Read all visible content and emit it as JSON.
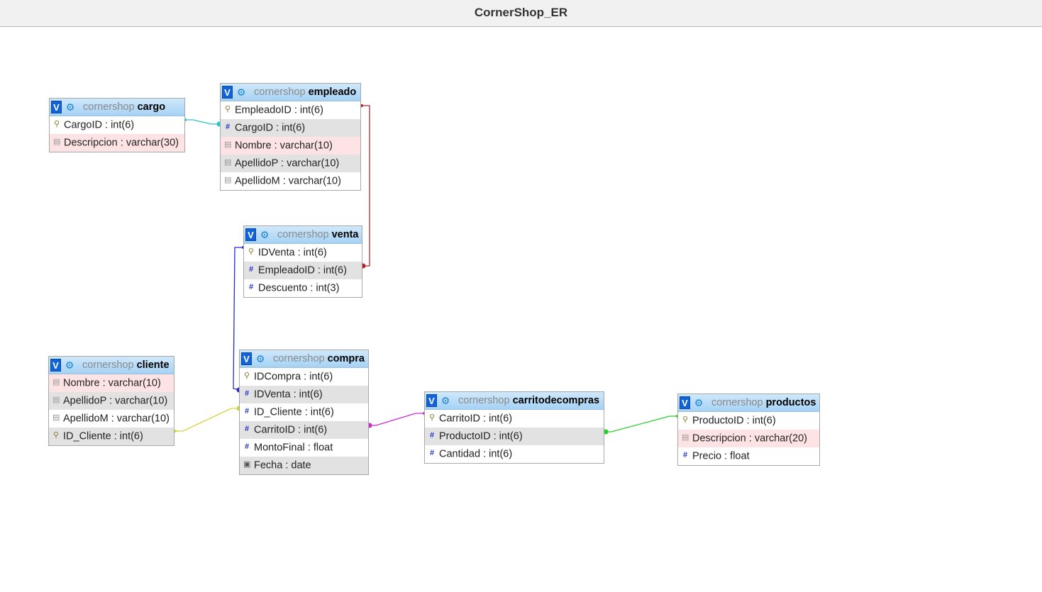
{
  "title": "CornerShop_ER",
  "tables": {
    "cargo": {
      "schema": "cornershop",
      "name": "cargo",
      "columns": [
        {
          "icon": "key-icon",
          "text": "CargoID : int(6)"
        },
        {
          "icon": "text-icon",
          "text": "Descripcion : varchar(30)"
        }
      ]
    },
    "empleado": {
      "schema": "cornershop",
      "name": "empleado",
      "columns": [
        {
          "icon": "key-icon",
          "text": "EmpleadoID : int(6)"
        },
        {
          "icon": "number-icon",
          "text": "CargoID : int(6)"
        },
        {
          "icon": "text-icon",
          "text": "Nombre : varchar(10)"
        },
        {
          "icon": "text-icon",
          "text": "ApellidoP : varchar(10)"
        },
        {
          "icon": "text-icon",
          "text": "ApellidoM : varchar(10)"
        }
      ]
    },
    "venta": {
      "schema": "cornershop",
      "name": "venta",
      "columns": [
        {
          "icon": "key-icon",
          "text": "IDVenta : int(6)"
        },
        {
          "icon": "number-icon",
          "text": "EmpleadoID : int(6)"
        },
        {
          "icon": "number-icon",
          "text": "Descuento : int(3)"
        }
      ]
    },
    "cliente": {
      "schema": "cornershop",
      "name": "cliente",
      "columns": [
        {
          "icon": "text-icon",
          "text": "Nombre : varchar(10)"
        },
        {
          "icon": "text-icon",
          "text": "ApellidoP : varchar(10)"
        },
        {
          "icon": "text-icon",
          "text": "ApellidoM : varchar(10)"
        },
        {
          "icon": "key-icon",
          "text": "ID_Cliente : int(6)"
        }
      ]
    },
    "compra": {
      "schema": "cornershop",
      "name": "compra",
      "columns": [
        {
          "icon": "key-icon",
          "text": "IDCompra : int(6)"
        },
        {
          "icon": "number-icon",
          "text": "IDVenta : int(6)"
        },
        {
          "icon": "number-icon",
          "text": "ID_Cliente : int(6)"
        },
        {
          "icon": "number-icon",
          "text": "CarritoID : int(6)"
        },
        {
          "icon": "number-icon",
          "text": "MontoFinal : float"
        },
        {
          "icon": "date-icon",
          "text": "Fecha : date"
        }
      ]
    },
    "carritodecompras": {
      "schema": "cornershop",
      "name": "carritodecompras",
      "columns": [
        {
          "icon": "key-icon",
          "text": "CarritoID : int(6)"
        },
        {
          "icon": "number-icon",
          "text": "ProductoID : int(6)"
        },
        {
          "icon": "number-icon",
          "text": "Cantidad : int(6)"
        }
      ]
    },
    "productos": {
      "schema": "cornershop",
      "name": "productos",
      "columns": [
        {
          "icon": "key-icon",
          "text": "ProductoID : int(6)"
        },
        {
          "icon": "text-icon",
          "text": "Descripcion : varchar(20)"
        },
        {
          "icon": "number-icon",
          "text": "Precio : float"
        }
      ]
    }
  },
  "toggle_label": "V",
  "relationships": [
    {
      "from": "empleado.CargoID",
      "to": "cargo.CargoID",
      "color": "#2ec4c4"
    },
    {
      "from": "venta.EmpleadoID",
      "to": "empleado.EmpleadoID",
      "color": "#b3242f"
    },
    {
      "from": "compra.IDVenta",
      "to": "venta.IDVenta",
      "color": "#2a2acc"
    },
    {
      "from": "compra.ID_Cliente",
      "to": "cliente.ID_Cliente",
      "color": "#d6d23a"
    },
    {
      "from": "compra.CarritoID",
      "to": "carritodecompras.CarritoID",
      "color": "#cc2acc"
    },
    {
      "from": "carritodecompras.ProductoID",
      "to": "productos.ProductoID",
      "color": "#2acc2a"
    }
  ]
}
